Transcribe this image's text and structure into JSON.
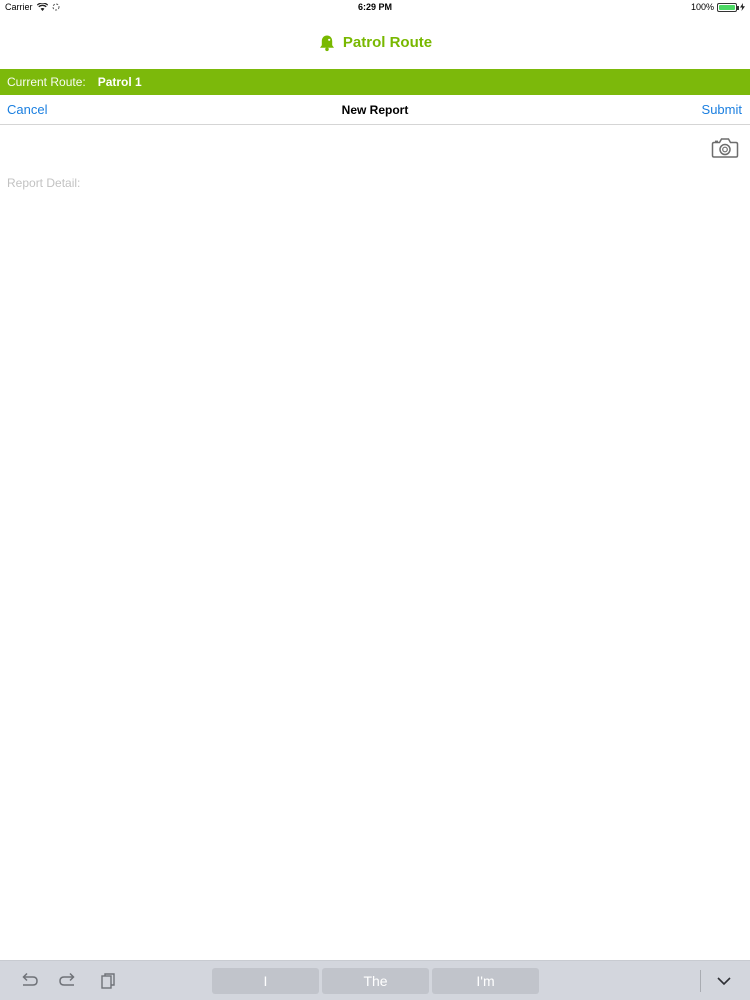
{
  "status_bar": {
    "carrier": "Carrier",
    "time": "6:29 PM",
    "battery": "100%",
    "battery_level": 1.0,
    "icons": [
      "wifi-icon",
      "activity-icon",
      "battery-icon",
      "charging-icon"
    ]
  },
  "app_header": {
    "title": "Patrol Route",
    "icon": "bell-icon",
    "accent_color": "#78b800"
  },
  "route_bar": {
    "label": "Current Route:",
    "value": "Patrol 1",
    "color": "#7cb90b"
  },
  "nav": {
    "cancel_label": "Cancel",
    "title": "New Report",
    "submit_label": "Submit",
    "link_color": "#1b7fe0"
  },
  "camera": {
    "icon": "camera-icon"
  },
  "report": {
    "value": "",
    "placeholder": "Report Detail:"
  },
  "keyboard_bar": {
    "tools": [
      "undo-icon",
      "redo-icon",
      "paste-icon"
    ],
    "suggestions": [
      "I",
      "The",
      "I'm"
    ],
    "dismiss_icon": "chevron-down-icon"
  }
}
